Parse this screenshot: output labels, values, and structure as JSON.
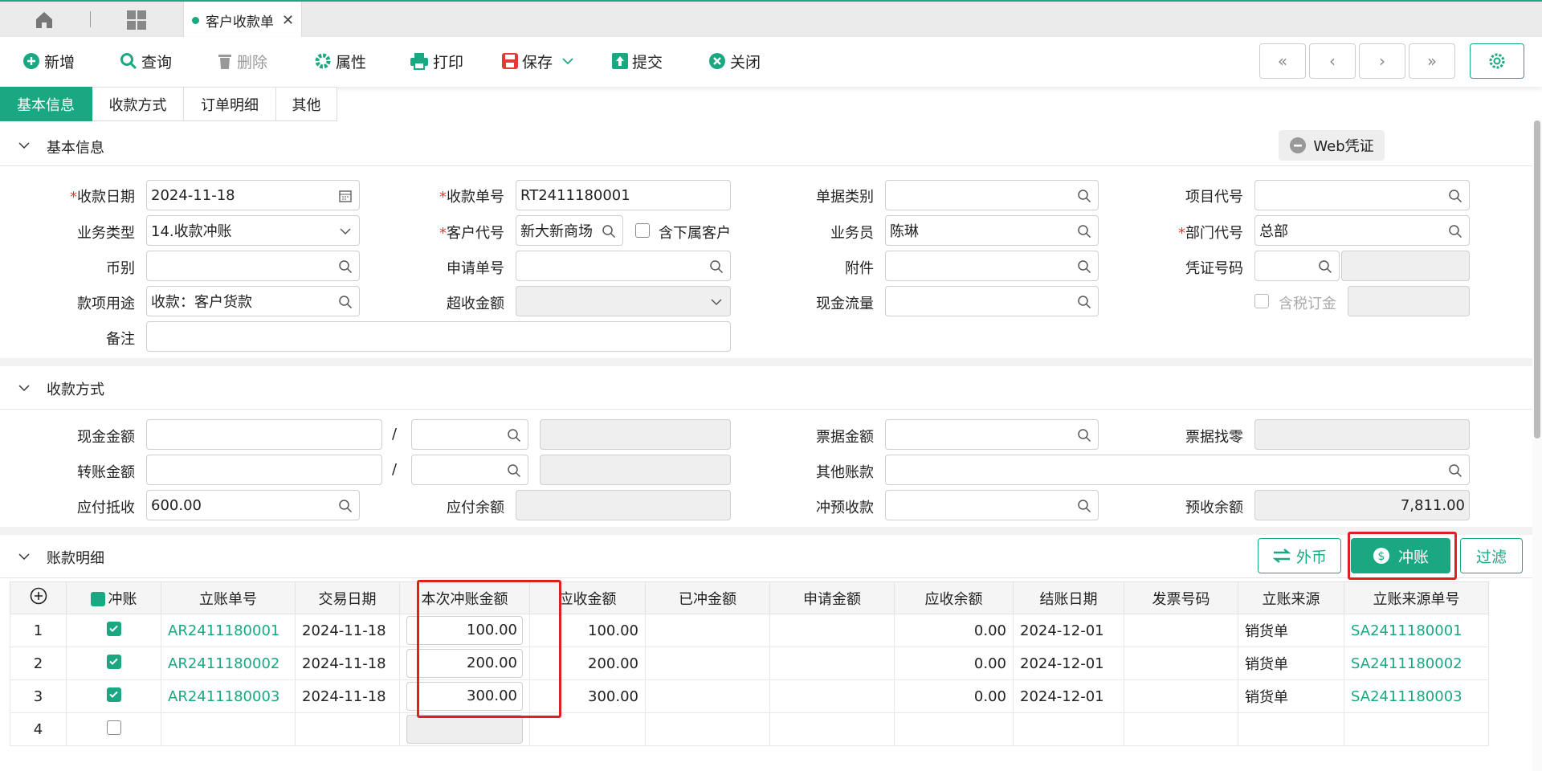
{
  "tab": {
    "title": "客户收款单"
  },
  "toolbar": {
    "add": "新增",
    "query": "查询",
    "delete": "删除",
    "props": "属性",
    "print": "打印",
    "save": "保存",
    "submit": "提交",
    "close": "关闭"
  },
  "section_tabs": [
    "基本信息",
    "收款方式",
    "订单明细",
    "其他"
  ],
  "basic": {
    "title": "基本信息",
    "web_voucher": "Web凭证",
    "labels": {
      "date": "收款日期",
      "bill_no": "收款单号",
      "doc_type": "单据类别",
      "project": "项目代号",
      "biz_type": "业务类型",
      "customer": "客户代号",
      "include_sub": "含下属客户",
      "salesman": "业务员",
      "dept": "部门代号",
      "currency": "币别",
      "apply_no": "申请单号",
      "attach": "附件",
      "voucher_no": "凭证号码",
      "purpose": "款项用途",
      "over_amount": "超收金额",
      "cashflow": "现金流量",
      "tax_deposit": "含税订金",
      "remark": "备注"
    },
    "values": {
      "date": "2024-11-18",
      "bill_no": "RT2411180001",
      "biz_type": "14.收款冲账",
      "customer": "新大新商场",
      "salesman": "陈琳",
      "dept": "总部",
      "purpose": "收款：客户货款"
    }
  },
  "payment": {
    "title": "收款方式",
    "labels": {
      "cash": "现金金额",
      "transfer": "转账金额",
      "offset": "应付抵收",
      "payable_bal": "应付余额",
      "bill_amt": "票据金额",
      "bill_change": "票据找零",
      "other": "其他账款",
      "prepay_off": "冲预收款",
      "prepay_bal": "预收余额",
      "slash": "/"
    },
    "values": {
      "offset": "600.00",
      "prepay_bal": "7,811.00"
    }
  },
  "detail": {
    "title": "账款明细",
    "buttons": {
      "fx": "外币",
      "writeoff": "冲账",
      "filter": "过滤"
    },
    "columns": [
      "冲账",
      "立账单号",
      "交易日期",
      "本次冲账金额",
      "应收金额",
      "已冲金额",
      "申请金额",
      "应收余额",
      "结账日期",
      "发票号码",
      "立账来源",
      "立账来源单号"
    ],
    "rows": [
      {
        "no": "1",
        "checked": true,
        "ar": "AR2411180001",
        "date": "2024-11-18",
        "amount": "100.00",
        "receivable": "100.00",
        "paid": "",
        "apply": "",
        "balance": "0.00",
        "close_date": "2024-12-01",
        "invoice": "",
        "source": "销货单",
        "source_no": "SA2411180001"
      },
      {
        "no": "2",
        "checked": true,
        "ar": "AR2411180002",
        "date": "2024-11-18",
        "amount": "200.00",
        "receivable": "200.00",
        "paid": "",
        "apply": "",
        "balance": "0.00",
        "close_date": "2024-12-01",
        "invoice": "",
        "source": "销货单",
        "source_no": "SA2411180002"
      },
      {
        "no": "3",
        "checked": true,
        "ar": "AR2411180003",
        "date": "2024-11-18",
        "amount": "300.00",
        "receivable": "300.00",
        "paid": "",
        "apply": "",
        "balance": "0.00",
        "close_date": "2024-12-01",
        "invoice": "",
        "source": "销货单",
        "source_no": "SA2411180003"
      },
      {
        "no": "4",
        "checked": false,
        "ar": "",
        "date": "",
        "amount": "",
        "receivable": "",
        "paid": "",
        "apply": "",
        "balance": "",
        "close_date": "",
        "invoice": "",
        "source": "",
        "source_no": ""
      }
    ]
  },
  "colors": {
    "accent": "#19a882",
    "required": "#e53935",
    "highlight": "#e02020"
  }
}
